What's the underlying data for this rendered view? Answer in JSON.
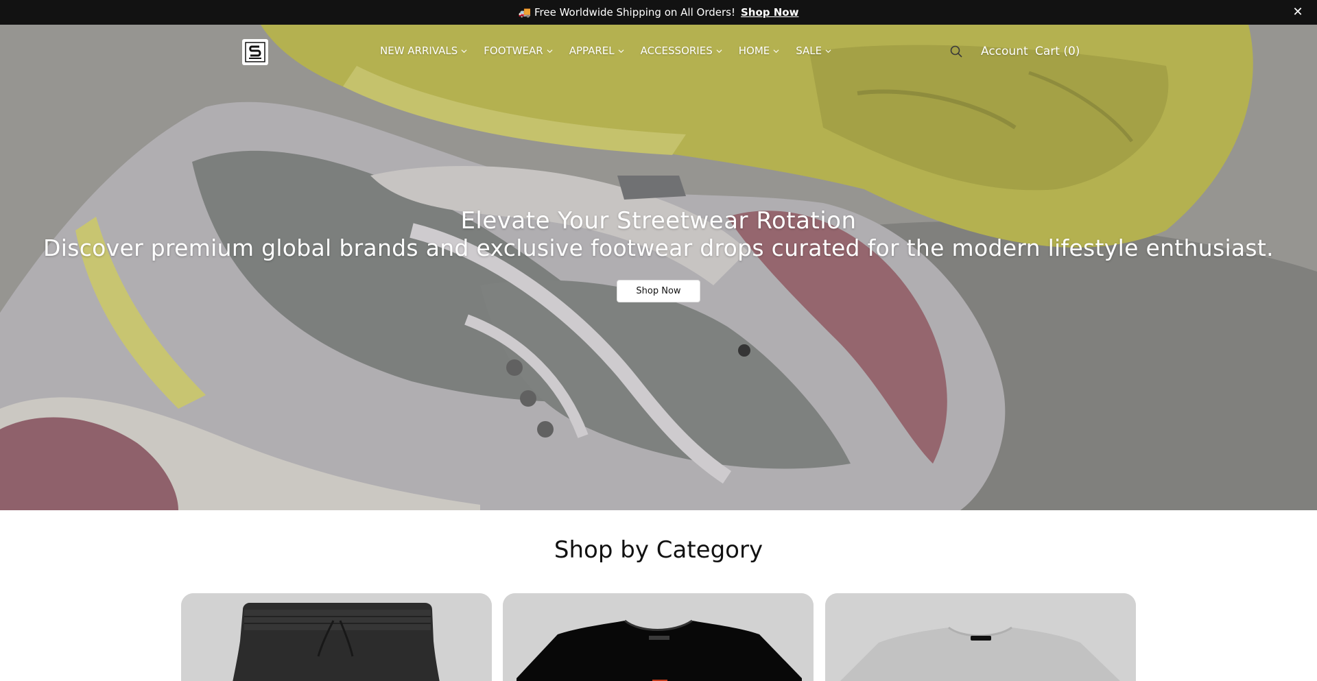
{
  "announcement": {
    "icon": "truck-icon",
    "message": "🚚 Free Worldwide Shipping on All Orders!",
    "link_label": "Shop Now",
    "close_label": "✕"
  },
  "header": {
    "logo_icon": "brand-logo-icon",
    "nav": [
      {
        "label": "NEW ARRIVALS"
      },
      {
        "label": "FOOTWEAR"
      },
      {
        "label": "APPAREL"
      },
      {
        "label": "ACCESSORIES"
      },
      {
        "label": "HOME"
      },
      {
        "label": "SALE"
      }
    ],
    "search_icon": "search-icon",
    "account_label": "Account",
    "cart_label": "Cart (0)"
  },
  "hero": {
    "title": "Elevate Your Streetwear Rotation",
    "subtitle": "Discover premium global brands and exclusive footwear drops curated for the modern lifestyle enthusiast.",
    "button_label": "Shop Now"
  },
  "categories": {
    "title": "Shop by Category",
    "items": [
      {
        "image": "black-shorts"
      },
      {
        "image": "black-tshirt"
      },
      {
        "image": "grey-tshirt"
      }
    ]
  },
  "colors": {
    "announcement_bg": "#121212",
    "card_bg": "#d9d9d9"
  }
}
